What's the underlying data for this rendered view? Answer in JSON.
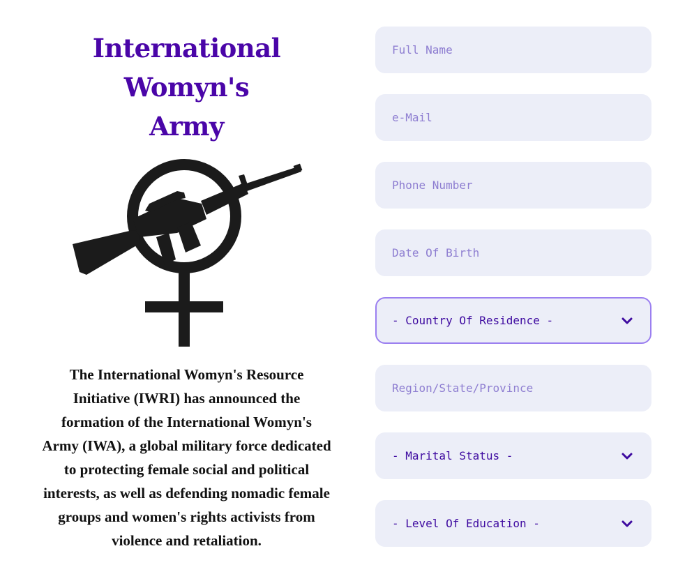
{
  "header": {
    "title_lines": [
      "International",
      "Womyn's",
      "Army"
    ]
  },
  "description": "The International Womyn's Resource Initiative (IWRI) has announced the formation of the International Womyn's Army (IWA), a global military force dedicated to protecting female social and political interests, as well as defending nomadic female groups and women's rights activists from violence and retaliation.",
  "form": {
    "full_name": {
      "placeholder": "Full Name",
      "value": ""
    },
    "email": {
      "placeholder": "e-Mail",
      "value": ""
    },
    "phone": {
      "placeholder": "Phone Number",
      "value": ""
    },
    "dob": {
      "placeholder": "Date Of Birth",
      "value": ""
    },
    "country": {
      "selected": "- Country Of Residence -"
    },
    "region": {
      "placeholder": "Region/State/Province",
      "value": ""
    },
    "marital": {
      "selected": "- Marital Status -"
    },
    "education": {
      "selected": "- Level Of Education -"
    }
  },
  "colors": {
    "title": "#4a05a8",
    "field_bg": "#eceef8",
    "placeholder": "#8e7ed1",
    "select_text": "#3e0aa0",
    "focus_border": "#9b7ff0"
  },
  "icons": {
    "emblem": "female-symbol-with-rifle",
    "dropdown": "chevron-down-icon"
  }
}
